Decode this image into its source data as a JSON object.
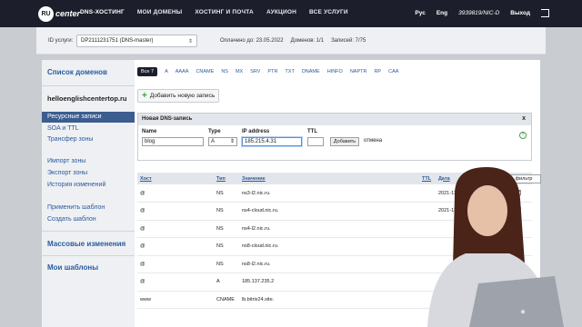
{
  "topbar": {
    "logo_ru": "RU",
    "logo_center": "center",
    "nav": [
      "DNS-ХОСТИНГ",
      "МОИ ДОМЕНЫ",
      "ХОСТИНГ И ПОЧТА",
      "АУКЦИОН",
      "ВСЕ УСЛУГИ"
    ],
    "lang_ru": "Рус",
    "lang_en": "Eng",
    "account": "3939819/NIC-D",
    "exit": "Выход"
  },
  "servicebar": {
    "label": "ID услуги:",
    "service_value": "DP2111231751 (DNS-master)",
    "paid_until": "Оплачено до: 23.05.2022",
    "domains": "Доменов: 1/1",
    "records": "Записей: 7/75"
  },
  "sidebar": {
    "domains_title": "Список доменов",
    "domain_name": "helloenglishcentertop.ru",
    "items": [
      {
        "label": "Ресурсные записи",
        "active": true
      },
      {
        "label": "SOA и TTL"
      },
      {
        "label": "Трансфер зоны"
      },
      {
        "label": "Импорт зоны"
      },
      {
        "label": "Экспорт зоны"
      },
      {
        "label": "История изменений"
      },
      {
        "label": "Применить шаблон"
      },
      {
        "label": "Создать шаблон"
      }
    ],
    "mass_changes": "Массовые изменения",
    "my_templates": "Мои шаблоны"
  },
  "tabs": [
    "Все 7",
    "A",
    "AAAA",
    "CNAME",
    "NS",
    "MX",
    "SRV",
    "PTR",
    "TXT",
    "DNAME",
    "HINFO",
    "NAPTR",
    "RP",
    "CAA"
  ],
  "add_record_label": "Добавить новую запись",
  "new_record": {
    "title": "Новая DNS-запись",
    "close": "x",
    "name_label": "Name",
    "name_value": "blog",
    "type_label": "Type",
    "type_value": "A",
    "ip_label": "IP address",
    "ip_value": "185.215.4.31",
    "ttl_label": "TTL",
    "ttl_value": "",
    "add_button": "Добавить",
    "cancel": "отмена",
    "help": "?"
  },
  "table": {
    "headers": [
      "Хост",
      "Тип",
      "Значение",
      "TTL",
      "Дата"
    ],
    "filter": "фильтр",
    "rows": [
      [
        "@",
        "NS",
        "ns3-l2.nic.ru.",
        "",
        "2021-11-2"
      ],
      [
        "@",
        "NS",
        "ns4-cloud.nic.ru.",
        "",
        "2021-11"
      ],
      [
        "@",
        "NS",
        "ns4-l2.nic.ru.",
        "",
        ""
      ],
      [
        "@",
        "NS",
        "ns8-cloud.nic.ru.",
        "",
        ""
      ],
      [
        "@",
        "NS",
        "ns8-l2.nic.ru.",
        "",
        ""
      ],
      [
        "@",
        "A",
        "185.137.235.2",
        "",
        ""
      ],
      [
        "www",
        "CNAME",
        "lb.bitrix24.site.",
        "",
        ""
      ]
    ]
  },
  "colors": {
    "topbar": "#1c1f2b",
    "link": "#2b5b9e",
    "active_side": "#3c5d8f"
  }
}
